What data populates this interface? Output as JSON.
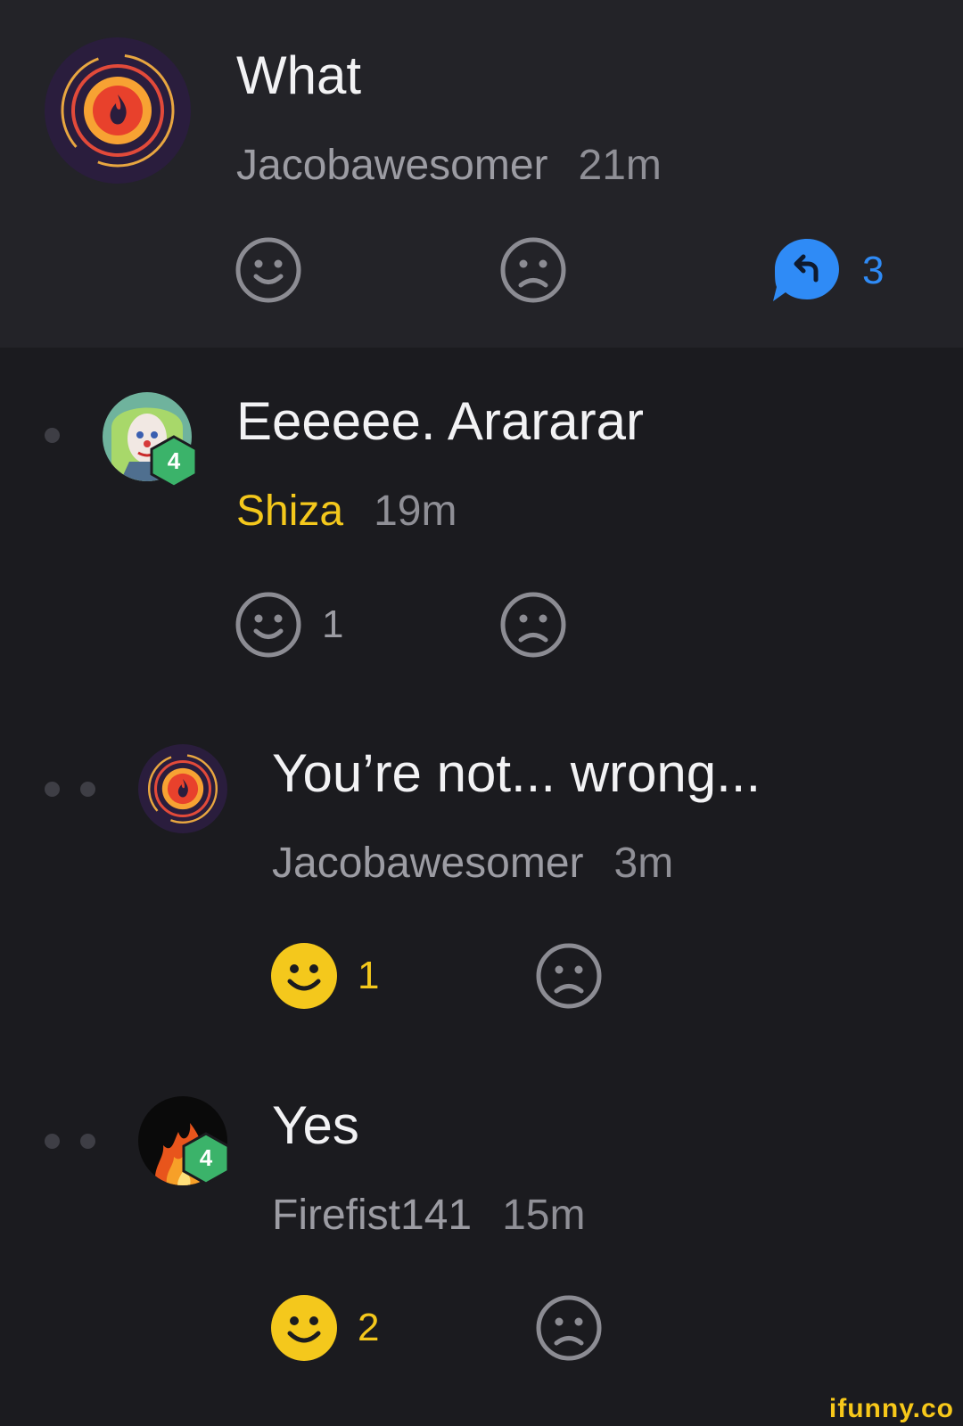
{
  "comments": [
    {
      "text": "What",
      "username": "Jacobawesomer",
      "time": "21m",
      "like_count": "",
      "reply_count": "3"
    },
    {
      "text": "Eeeeee. Arararar",
      "username": "Shiza",
      "time": "19m",
      "like_count": "1",
      "badge": "4"
    },
    {
      "text": "You’re not... wrong...",
      "username": "Jacobawesomer",
      "time": "3m",
      "like_count": "1"
    },
    {
      "text": "Yes",
      "username": "Firefist141",
      "time": "15m",
      "like_count": "2",
      "badge": "4"
    }
  ],
  "watermark": "ifunny.co",
  "colors": {
    "background": "#1b1b1f",
    "highlight_background": "#232328",
    "accent_gold": "#f4c81c",
    "accent_blue": "#2f8bf6",
    "badge_green": "#3bb36a"
  },
  "icons": [
    "smile-icon",
    "frown-icon",
    "reply-bubble-icon",
    "level-badge-icon"
  ]
}
